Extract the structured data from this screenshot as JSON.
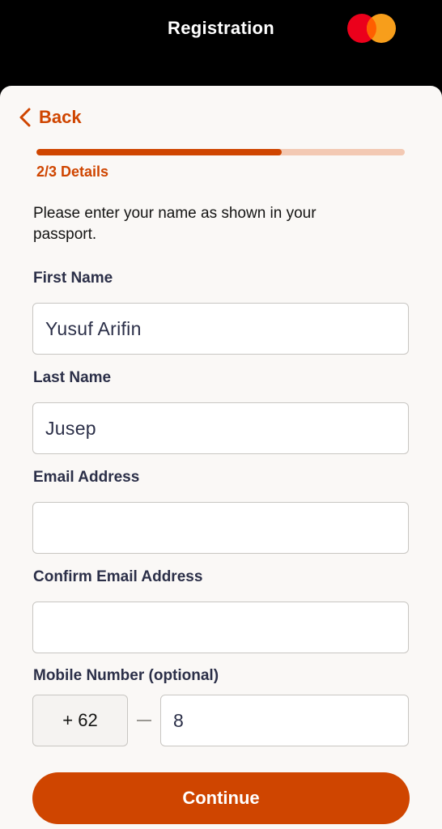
{
  "header": {
    "title": "Registration",
    "brand_icon": "mastercard-logo-icon",
    "brand_colors": {
      "red": "#eb001b",
      "orange": "#f79e1b",
      "overlap": "#ff5f00"
    }
  },
  "nav": {
    "back_label": "Back",
    "back_icon": "chevron-left-icon"
  },
  "progress": {
    "step_label": "2/3 Details",
    "fraction": 0.667,
    "accent": "#cf4500",
    "track": "#f3c9b3"
  },
  "instructions": "Please enter your name as shown in your passport.",
  "form": {
    "first_name": {
      "label": "First Name",
      "value": "Yusuf Arifin"
    },
    "last_name": {
      "label": "Last Name",
      "value": "Jusep"
    },
    "email": {
      "label": "Email Address",
      "value": ""
    },
    "confirm_email": {
      "label": "Confirm Email Address",
      "value": ""
    },
    "mobile": {
      "label": "Mobile Number (optional)",
      "country_code": "+ 62",
      "value": "8"
    }
  },
  "actions": {
    "continue_label": "Continue"
  }
}
